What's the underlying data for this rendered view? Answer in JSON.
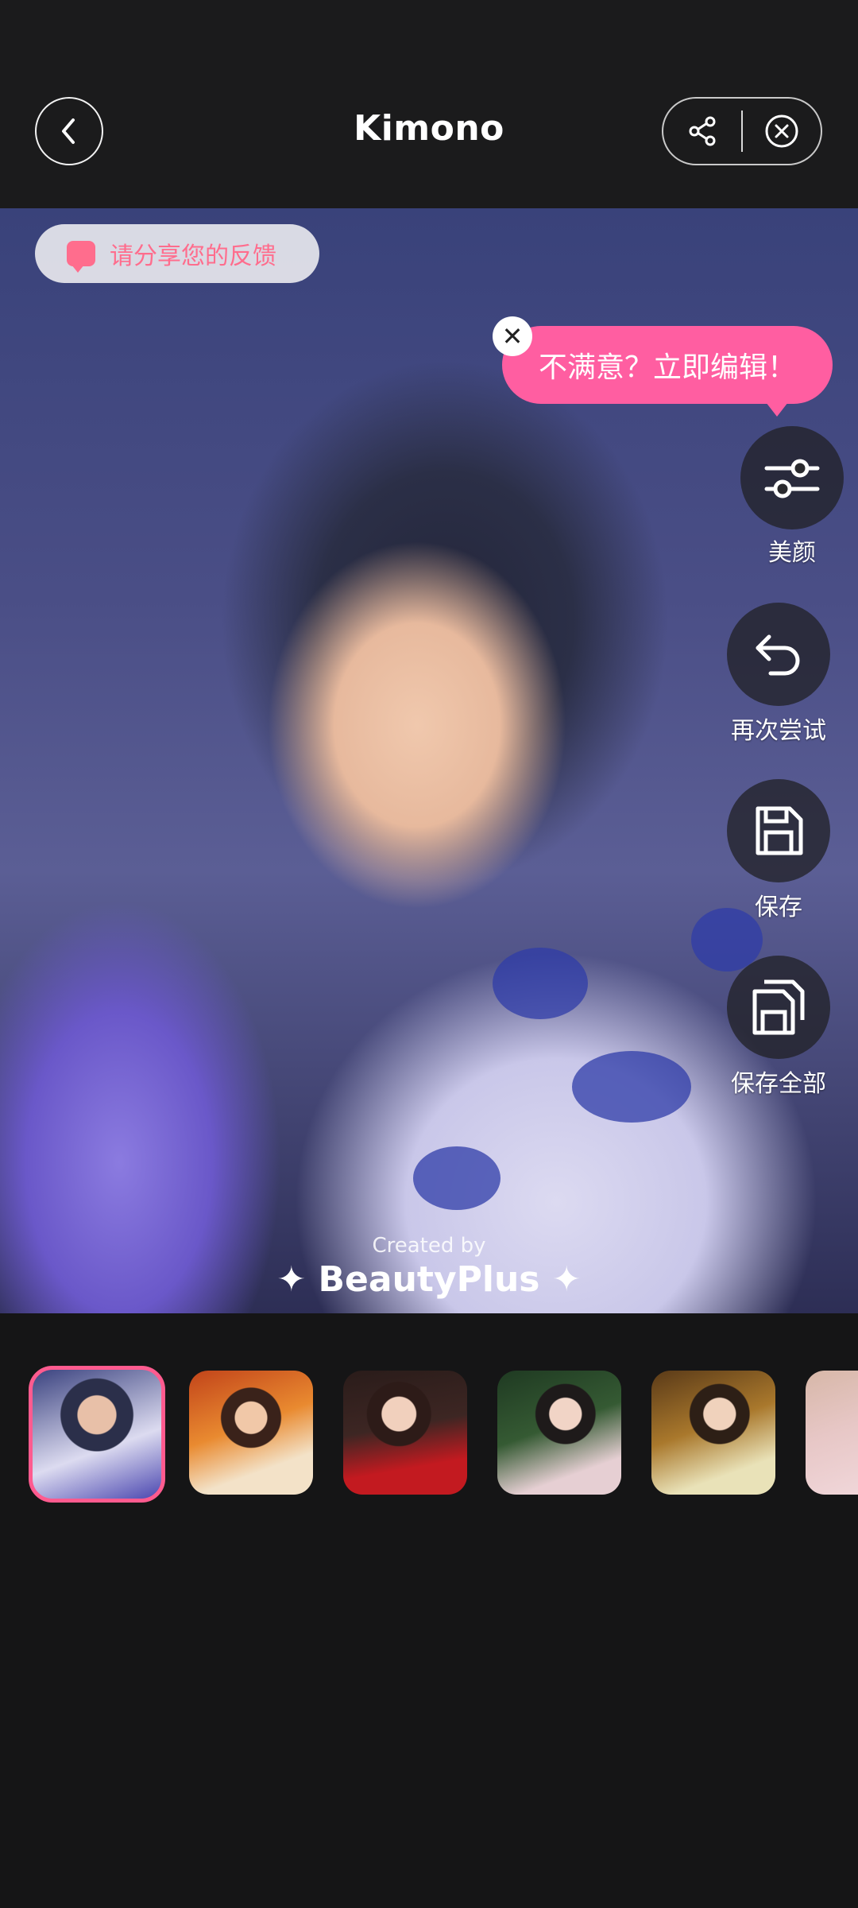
{
  "header": {
    "title": "Kimono"
  },
  "photo": {
    "feedback_label": "请分享您的反馈",
    "tooltip_text": "不满意？立即编辑！",
    "watermark_small": "Created by",
    "watermark_brand": "✦ BeautyPlus ✦"
  },
  "side_tools": [
    {
      "label": "美颜",
      "icon": "sliders-icon"
    },
    {
      "label": "再次尝试",
      "icon": "undo-icon"
    },
    {
      "label": "保存",
      "icon": "save-icon"
    },
    {
      "label": "保存全部",
      "icon": "save-all-icon"
    }
  ],
  "thumbnails": {
    "count_visible": 6,
    "selected_index": 0
  },
  "colors": {
    "accent_pink": "#ff5ea1",
    "background": "#151516"
  }
}
